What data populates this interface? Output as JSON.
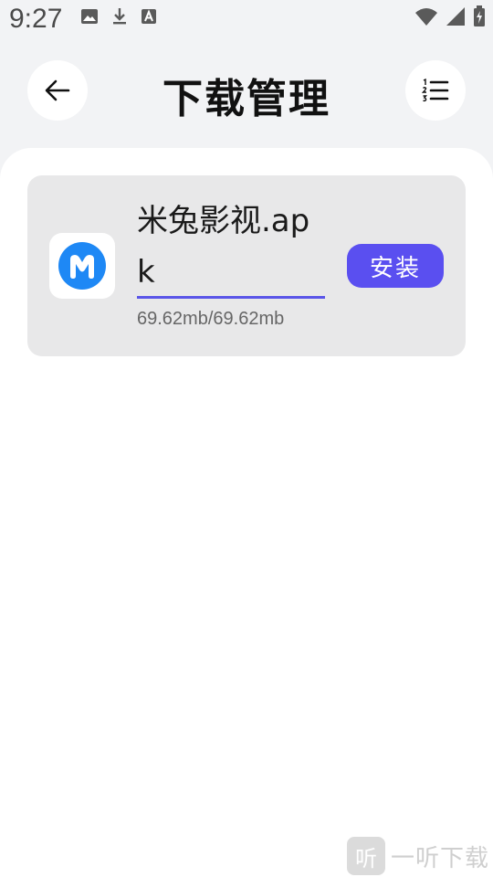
{
  "status_bar": {
    "time": "9:27",
    "left_icons": [
      "image-icon",
      "download-icon",
      "font-icon"
    ],
    "right_icons": [
      "wifi-icon",
      "signal-icon",
      "battery-icon"
    ]
  },
  "header": {
    "title": "下载管理",
    "back_icon": "back-arrow-icon",
    "list_icon": "numbered-list-icon"
  },
  "downloads": [
    {
      "file_name": "米兔影视.apk",
      "size_text": "69.62mb/69.62mb",
      "progress": 1.0,
      "action_label": "安装",
      "icon": "app-logo-icon"
    }
  ],
  "watermark": {
    "logo_char": "听",
    "text": "一听下载"
  },
  "colors": {
    "accent": "#5a4ff0",
    "progress": "#5a55e8",
    "app_logo_blue": "#1e88f5",
    "background": "#f2f3f5",
    "card": "#e8e8e9"
  }
}
